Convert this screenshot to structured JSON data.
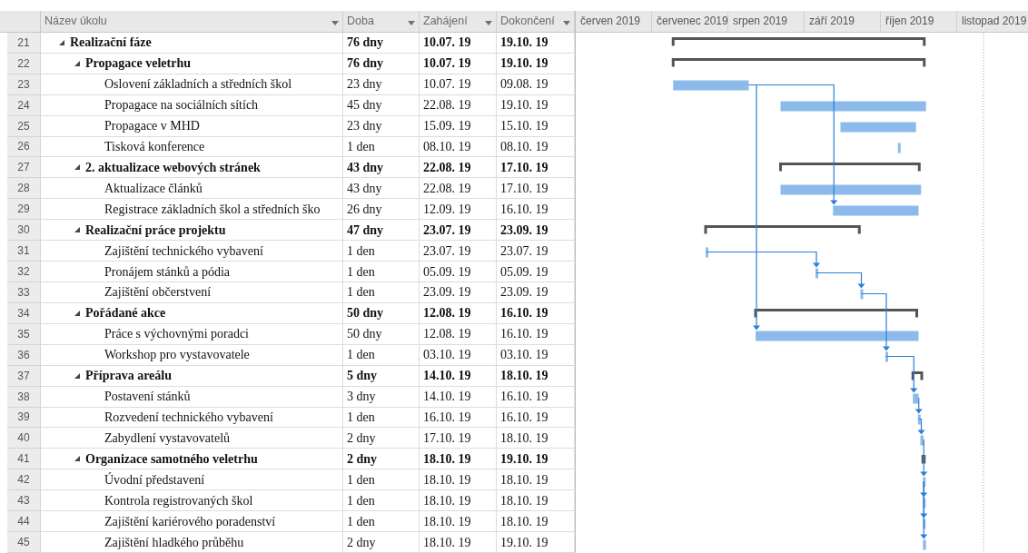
{
  "table": {
    "columns": [
      {
        "label": "Název úkolu"
      },
      {
        "label": "Doba"
      },
      {
        "label": "Zahájení"
      },
      {
        "label": "Dokončení"
      }
    ],
    "rows": [
      {
        "row_number": "21",
        "kind": "summary",
        "expanded": true,
        "name": "Realizační fáze",
        "duration": "76 dny",
        "start": "10.07. 19",
        "finish": "19.10. 19",
        "children": [
          {
            "row_number": "22",
            "kind": "summary",
            "expanded": true,
            "name": "Propagace veletrhu",
            "duration": "76 dny",
            "start": "10.07. 19",
            "finish": "19.10. 19",
            "children": [
              {
                "row_number": "23",
                "kind": "task",
                "name": "Oslovení základních a středních škol",
                "duration": "23 dny",
                "start": "10.07. 19",
                "finish": "09.08. 19"
              },
              {
                "row_number": "24",
                "kind": "task",
                "name": "Propagace na sociálních sítích",
                "duration": "45 dny",
                "start": "22.08. 19",
                "finish": "19.10. 19"
              },
              {
                "row_number": "25",
                "kind": "task",
                "name": "Propagace v MHD",
                "duration": "23 dny",
                "start": "15.09. 19",
                "finish": "15.10. 19"
              },
              {
                "row_number": "26",
                "kind": "task",
                "name": "Tisková konference",
                "duration": "1 den",
                "start": "08.10. 19",
                "finish": "08.10. 19"
              }
            ]
          },
          {
            "row_number": "27",
            "kind": "summary",
            "expanded": true,
            "name": "2. aktualizace webových stránek",
            "duration": "43 dny",
            "start": "22.08. 19",
            "finish": "17.10. 19",
            "children": [
              {
                "row_number": "28",
                "kind": "task",
                "name": "Aktualizace článků",
                "duration": "43 dny",
                "start": "22.08. 19",
                "finish": "17.10. 19"
              },
              {
                "row_number": "29",
                "kind": "task",
                "name": "Registrace základních škol a středních ško",
                "duration": "26 dny",
                "start": "12.09. 19",
                "finish": "16.10. 19"
              }
            ]
          },
          {
            "row_number": "30",
            "kind": "summary",
            "expanded": true,
            "name": "Realizační práce projektu",
            "duration": "47 dny",
            "start": "23.07. 19",
            "finish": "23.09. 19",
            "children": [
              {
                "row_number": "31",
                "kind": "task",
                "name": "Zajištění technického vybavení",
                "duration": "1 den",
                "start": "23.07. 19",
                "finish": "23.07. 19"
              },
              {
                "row_number": "32",
                "kind": "task",
                "name": "Pronájem stánků a pódia",
                "duration": "1 den",
                "start": "05.09. 19",
                "finish": "05.09. 19"
              },
              {
                "row_number": "33",
                "kind": "task",
                "name": "Zajištění občerstvení",
                "duration": "1 den",
                "start": "23.09. 19",
                "finish": "23.09. 19"
              }
            ]
          },
          {
            "row_number": "34",
            "kind": "summary",
            "expanded": true,
            "name": "Pořádané akce",
            "duration": "50 dny",
            "start": "12.08. 19",
            "finish": "16.10. 19",
            "children": [
              {
                "row_number": "35",
                "kind": "task",
                "name": "Práce s výchovnými poradci",
                "duration": "50 dny",
                "start": "12.08. 19",
                "finish": "16.10. 19"
              },
              {
                "row_number": "36",
                "kind": "task",
                "name": "Workshop pro vystavovatele",
                "duration": "1 den",
                "start": "03.10. 19",
                "finish": "03.10. 19"
              }
            ]
          },
          {
            "row_number": "37",
            "kind": "summary",
            "expanded": true,
            "name": "Příprava areálu",
            "duration": "5 dny",
            "start": "14.10. 19",
            "finish": "18.10. 19",
            "children": [
              {
                "row_number": "38",
                "kind": "task",
                "name": "Postavení stánků",
                "duration": "3 dny",
                "start": "14.10. 19",
                "finish": "16.10. 19"
              },
              {
                "row_number": "39",
                "kind": "task",
                "name": "Rozvedení technického vybavení",
                "duration": "1 den",
                "start": "16.10. 19",
                "finish": "16.10. 19"
              },
              {
                "row_number": "40",
                "kind": "task",
                "name": "Zabydlení vystavovatelů",
                "duration": "2 dny",
                "start": "17.10. 19",
                "finish": "18.10. 19"
              }
            ]
          },
          {
            "row_number": "41",
            "kind": "summary",
            "expanded": true,
            "name": "Organizace samotného veletrhu",
            "duration": "2 dny",
            "start": "18.10. 19",
            "finish": "19.10. 19",
            "children": [
              {
                "row_number": "42",
                "kind": "task",
                "name": "Úvodní představení",
                "duration": "1 den",
                "start": "18.10. 19",
                "finish": "18.10. 19"
              },
              {
                "row_number": "43",
                "kind": "task",
                "name": "Kontrola registrovaných škol",
                "duration": "1 den",
                "start": "18.10. 19",
                "finish": "18.10. 19"
              },
              {
                "row_number": "44",
                "kind": "task",
                "name": "Zajištění kariérového poradenství",
                "duration": "1 den",
                "start": "18.10. 19",
                "finish": "18.10. 19"
              },
              {
                "row_number": "45",
                "kind": "task",
                "name": "Zajištění hladkého průběhu",
                "duration": "2 dny",
                "start": "18.10. 19",
                "finish": "19.10. 19"
              }
            ]
          }
        ]
      }
    ]
  },
  "timeline": {
    "months": [
      {
        "label": "červen 2019"
      },
      {
        "label": "červenec 2019"
      },
      {
        "label": "srpen 2019"
      },
      {
        "label": "září 2019"
      },
      {
        "label": "říjen 2019"
      },
      {
        "label": "listopad 2019"
      }
    ]
  }
}
